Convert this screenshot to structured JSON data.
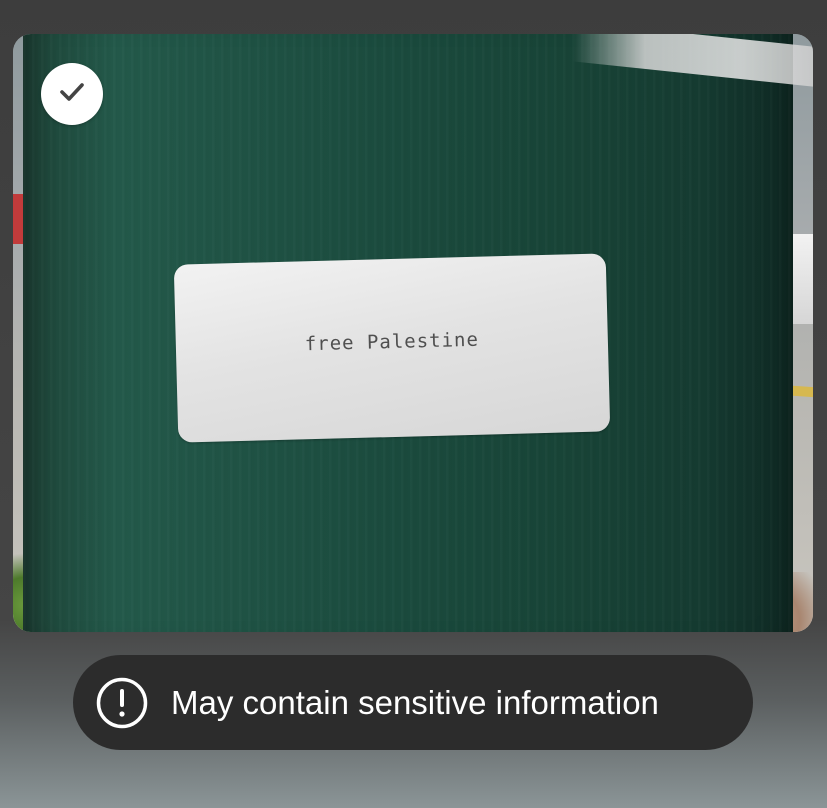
{
  "photo": {
    "sticker_text": "free Palestine",
    "selected": true
  },
  "select_control": {
    "icon": "check-icon"
  },
  "warning": {
    "icon": "exclamation-circle-icon",
    "text": "May contain sensitive information"
  },
  "colors": {
    "pill_background": "#2c2c2c",
    "pill_text": "#ffffff",
    "check_background": "#ffffff",
    "check_mark": "#444444"
  }
}
